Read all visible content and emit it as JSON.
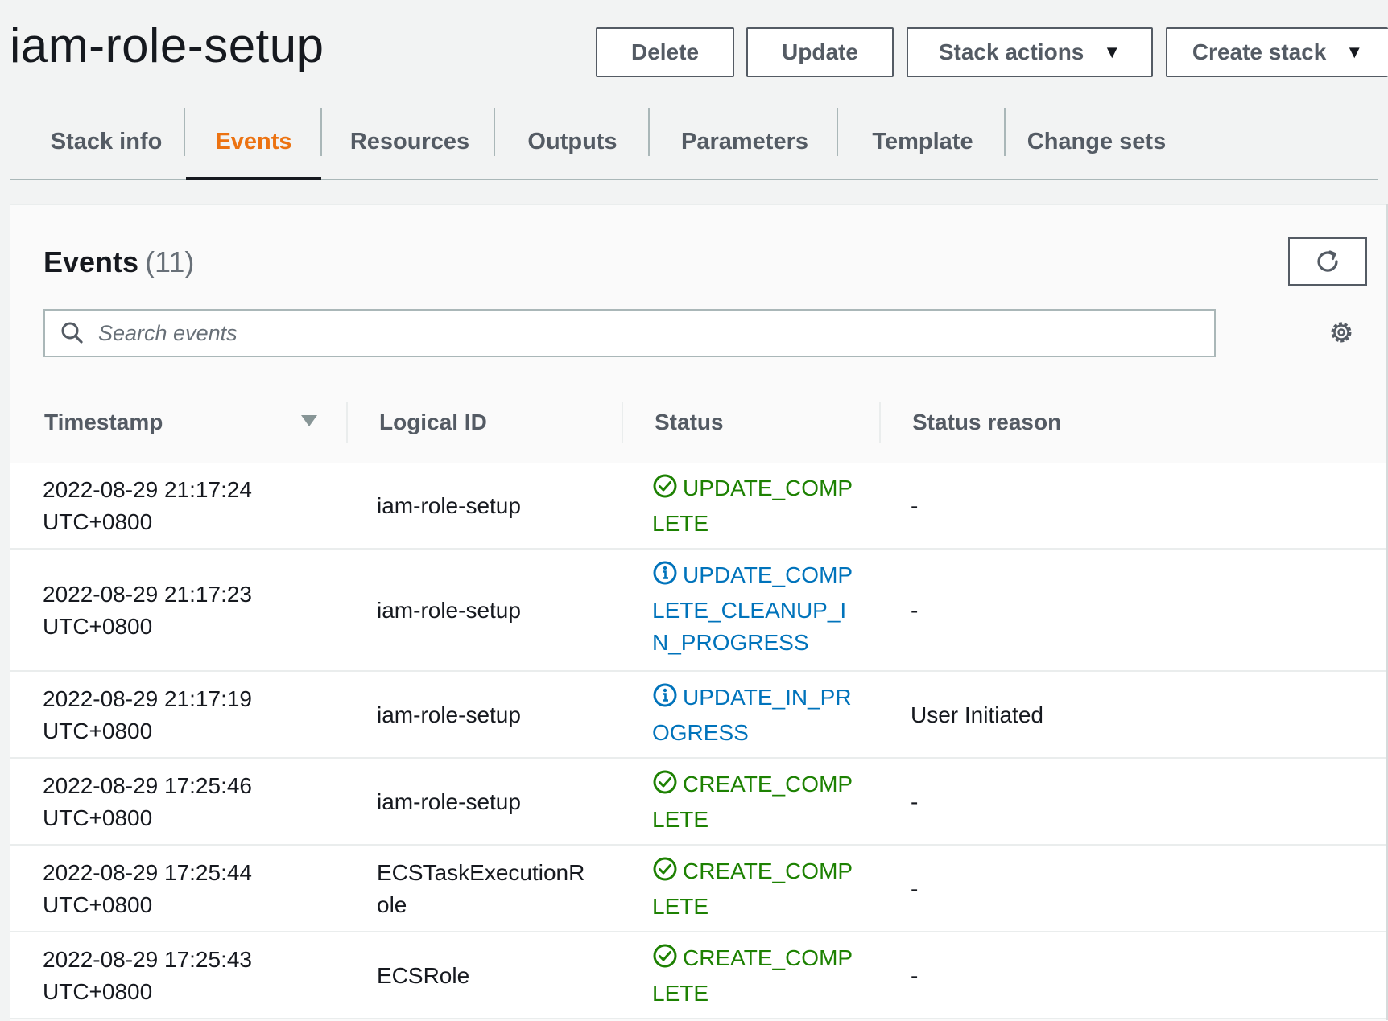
{
  "page": {
    "title": "iam-role-setup"
  },
  "actions": {
    "delete_label": "Delete",
    "update_label": "Update",
    "stack_actions_label": "Stack actions",
    "create_stack_label": "Create stack"
  },
  "tabs": [
    {
      "label": "Stack info",
      "active": false
    },
    {
      "label": "Events",
      "active": true
    },
    {
      "label": "Resources",
      "active": false
    },
    {
      "label": "Outputs",
      "active": false
    },
    {
      "label": "Parameters",
      "active": false
    },
    {
      "label": "Template",
      "active": false
    },
    {
      "label": "Change sets",
      "active": false
    }
  ],
  "events_panel": {
    "title": "Events",
    "count": "(11)",
    "search_placeholder": "Search events",
    "columns": [
      "Timestamp",
      "Logical ID",
      "Status",
      "Status reason"
    ],
    "rows": [
      {
        "timestamp": "2022-08-29 21:17:24 UTC+0800",
        "logical_id": "iam-role-setup",
        "status": "UPDATE_COMPLETE",
        "status_kind": "success",
        "reason": "-"
      },
      {
        "timestamp": "2022-08-29 21:17:23 UTC+0800",
        "logical_id": "iam-role-setup",
        "status": "UPDATE_COMPLETE_CLEANUP_IN_PROGRESS",
        "status_kind": "info",
        "reason": "-"
      },
      {
        "timestamp": "2022-08-29 21:17:19 UTC+0800",
        "logical_id": "iam-role-setup",
        "status": "UPDATE_IN_PROGRESS",
        "status_kind": "info",
        "reason": "User Initiated"
      },
      {
        "timestamp": "2022-08-29 17:25:46 UTC+0800",
        "logical_id": "iam-role-setup",
        "status": "CREATE_COMPLETE",
        "status_kind": "success",
        "reason": "-"
      },
      {
        "timestamp": "2022-08-29 17:25:44 UTC+0800",
        "logical_id": "ECSTaskExecutionRole",
        "status": "CREATE_COMPLETE",
        "status_kind": "success",
        "reason": "-"
      },
      {
        "timestamp": "2022-08-29 17:25:43 UTC+0800",
        "logical_id": "ECSRole",
        "status": "CREATE_COMPLETE",
        "status_kind": "success",
        "reason": "-"
      }
    ]
  },
  "colors": {
    "accent_orange": "#ec7211",
    "status_success": "#1d8102",
    "status_info": "#0073bb"
  },
  "icons": {
    "refresh": "refresh-icon",
    "search": "search-icon",
    "settings": "gear-icon",
    "sort": "sort-descending-icon",
    "success": "check-circle-icon",
    "info": "info-circle-icon",
    "dropdown": "caret-down-icon"
  }
}
